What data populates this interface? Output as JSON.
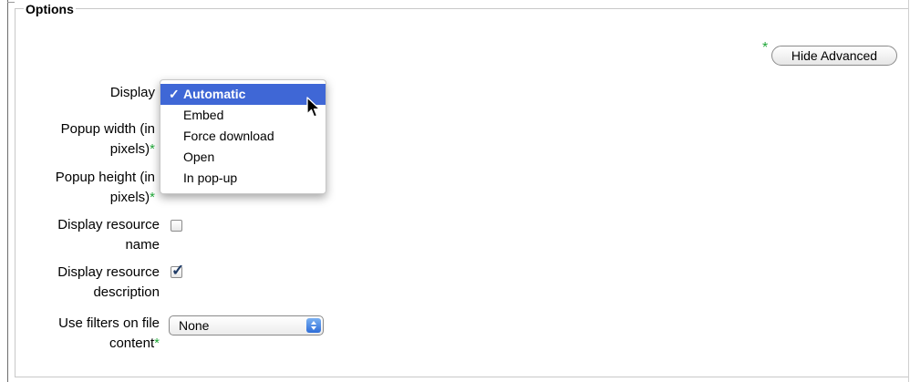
{
  "section": {
    "legend": "Options"
  },
  "advanced": {
    "required_mark": "*",
    "button_label": "Hide Advanced"
  },
  "fields": {
    "display": {
      "label": "Display"
    },
    "popup_width": {
      "label_line1": "Popup width (in",
      "label_line2": "pixels)",
      "required_mark": "*"
    },
    "popup_height": {
      "label_line1": "Popup height (in",
      "label_line2": "pixels)",
      "required_mark": "*"
    },
    "display_name": {
      "label_line1": "Display resource",
      "label_line2": "name",
      "checked": false
    },
    "display_description": {
      "label_line1": "Display resource",
      "label_line2": "description",
      "checked": true
    },
    "filters": {
      "label_line1": "Use filters on file",
      "label_line2": "content",
      "required_mark": "*",
      "value": "None"
    }
  },
  "dropdown": {
    "check_glyph": "✓",
    "options": [
      "Automatic",
      "Embed",
      "Force download",
      "Open",
      "In pop-up"
    ],
    "selected_index": 0
  },
  "colors": {
    "required": "#22a83a",
    "selection": "#3f67d6",
    "check": "#1f3b66"
  }
}
